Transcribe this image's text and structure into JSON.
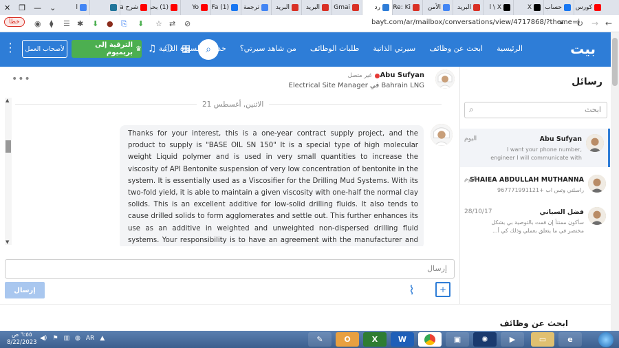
{
  "browser": {
    "tabs": [
      {
        "label": "كورس",
        "color": "#ff0000"
      },
      {
        "label": "حساب",
        "color": "#1877f2"
      },
      {
        "label": "X",
        "color": "#000000"
      },
      {
        "label": "X \\ ا",
        "color": "#000000"
      },
      {
        "label": "البريد",
        "color": "#d93025"
      },
      {
        "label": "الأمن",
        "color": "#4285f4"
      },
      {
        "label": "Re: Ki",
        "color": "#d93025"
      },
      {
        "label": "رد",
        "color": "#2e7dd7",
        "active": true
      },
      {
        "label": "Gmai",
        "color": "#d93025"
      },
      {
        "label": "البريد",
        "color": "#d93025"
      },
      {
        "label": "البريد",
        "color": "#d93025"
      },
      {
        "label": "ترجمة",
        "color": "#4285f4"
      },
      {
        "label": "(1) Fa",
        "color": "#1877f2"
      },
      {
        "label": "Yo",
        "color": "#ff0000"
      },
      {
        "label": "(1) بحر",
        "color": "#ff0000"
      },
      {
        "label": "شرح a",
        "color": "#ff0000"
      },
      {
        "label": "",
        "color": "#21759b"
      },
      {
        "label": "العمل",
        "color": "#4285f4"
      }
    ],
    "new_tab": "+",
    "url": "bayt.com/ar/mailbox/conversations/view/4717868/?theme=j",
    "error_label": "خطأ"
  },
  "header": {
    "logo": "بيت",
    "nav": [
      "الرئيسية",
      "ابحث عن وظائف",
      "سيرتي الذاتية",
      "طلبات الوظائف",
      "من شاهد سيرتي؟",
      "خدمات السيرة الذاتية"
    ],
    "premium_label": "الترقية إلى بريميوم",
    "employer_label": "لأصحاب العمل"
  },
  "messages_panel": {
    "title": "رسائل",
    "search_placeholder": "ابحث",
    "conversations": [
      {
        "name": "Abu Sufyan",
        "date": "اليوم",
        "preview": "I want your phone number, engineer I will communicate with you",
        "active": true
      },
      {
        "name": "SHAIEA ABDULLAH MUTHANNA",
        "date": "اليوم",
        "preview": "راسلني وتس اب +967771991121"
      },
      {
        "name": "فضل السياني",
        "date": "28/10/17",
        "preview": "سأكون ممتناً إن قمت بالتوصية بي بشكل مختصر في ما يتعلق بعملي وذلك كي أ..."
      }
    ]
  },
  "chat": {
    "contact_name": "Abu Sufyan",
    "status": "غير متصل",
    "role": "Electrical Site Manager في Bahrain LNG",
    "date_label": "الاثنين, أغسطس 21",
    "message": "Thanks for your interest, this is a one-year contract supply project, and the product to supply is \"BASE OIL SN 150\" It is a special type of high molecular weight Liquid polymer and is used in very small quantities to increase the viscosity of API Bentonite suspension of very low concentration of bentonite in the system. It is essentially used as a Viscosifier for the Drilling Mud Systems. With its two-fold yield, it is able to maintain a given viscosity with one-half the normal clay solids. This is an excellent additive for low-solid drilling fluids. It also tends to cause drilled solids to form agglomerates and settle out. This further enhances its use as an additive in weighted and unweighted non-dispersed drilling fluid systems. Your responsibility is to have an agreement with the manufacturer and make sure the chemical is supplied to our project site on a monthly basis after the contract is awarded to you. Bahrain",
    "input_placeholder": "إرسال",
    "send_label": "إرسال"
  },
  "lower": {
    "job_search_title": "ابحث عن وظائف"
  },
  "taskbar": {
    "time": "٦:٥٥ ص",
    "date": "8/22/2023",
    "lang": "AR"
  }
}
